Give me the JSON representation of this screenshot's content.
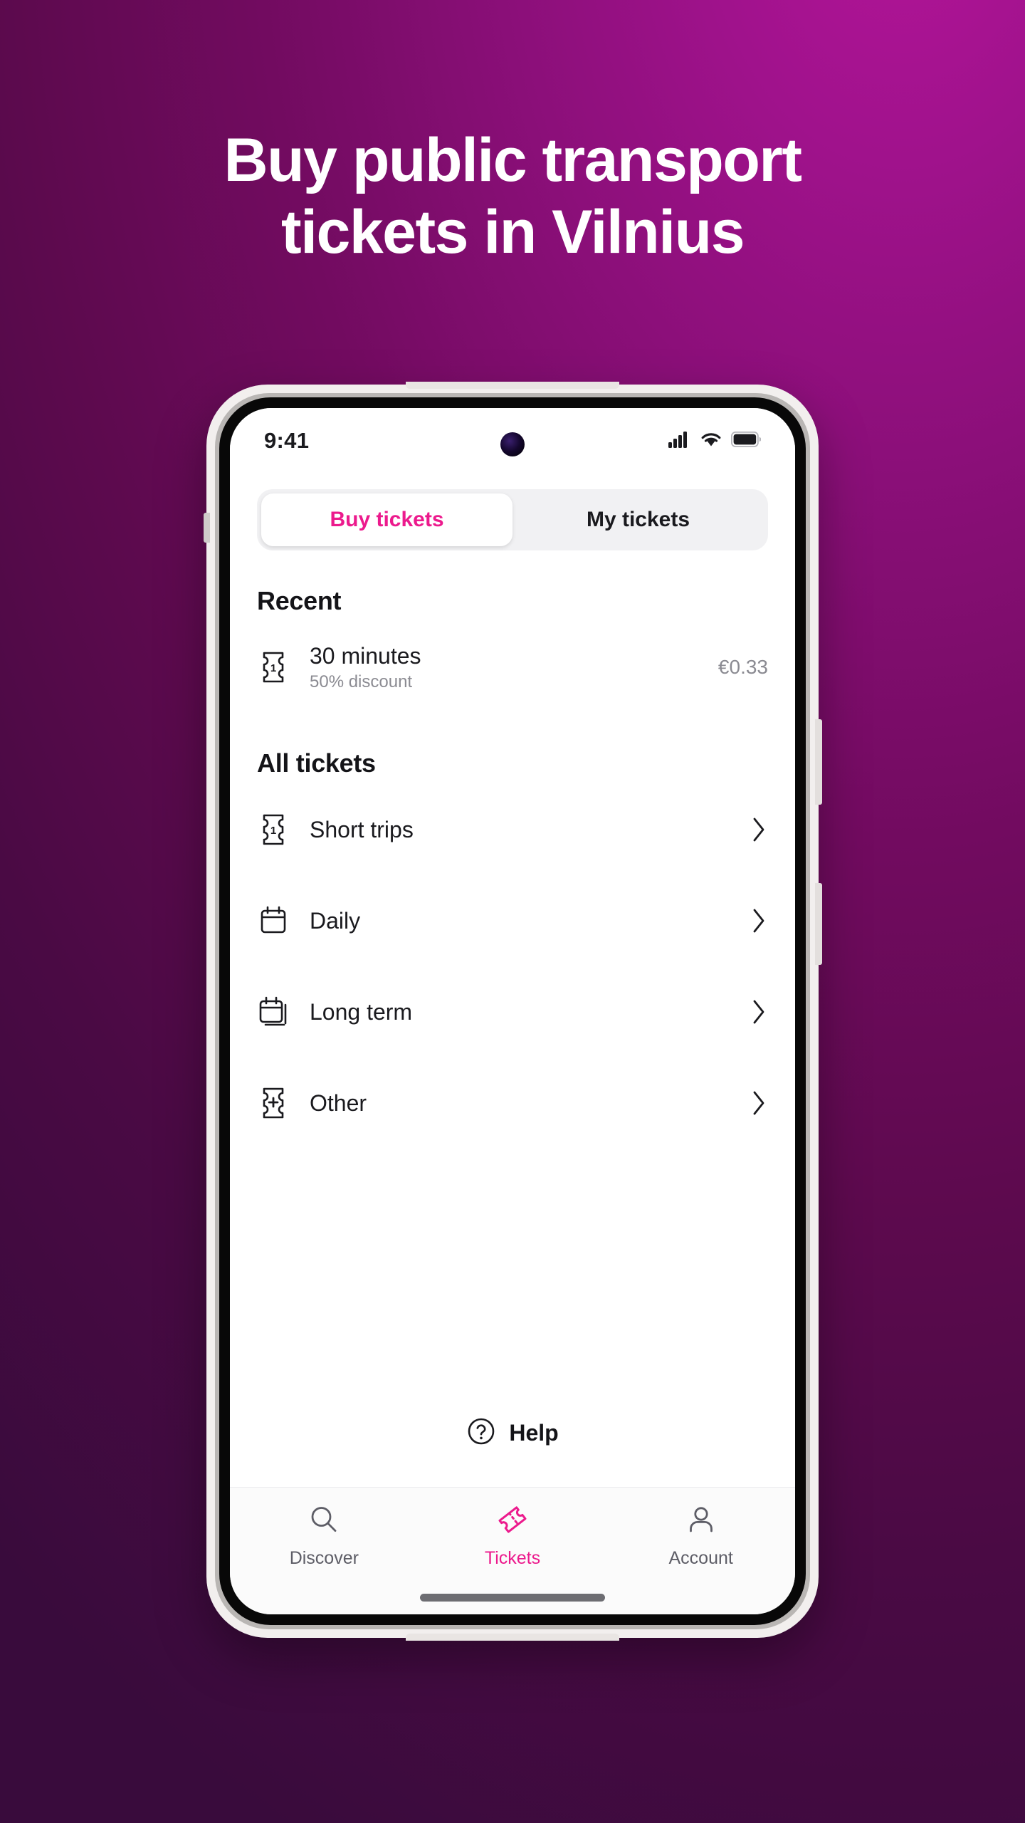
{
  "promo": {
    "headline_line1": "Buy public transport",
    "headline_line2": "tickets in Vilnius",
    "bg_color_start": "#b5159a",
    "bg_color_end": "#390b3c"
  },
  "phone": {
    "status_bar": {
      "time": "9:41",
      "signal_icon": "cellular-signal-icon",
      "wifi_icon": "wifi-icon",
      "battery_icon": "battery-full-icon",
      "camera": "front-camera-punchhole"
    },
    "tabs": [
      {
        "label": "Buy tickets",
        "active": true
      },
      {
        "label": "My tickets",
        "active": false
      }
    ],
    "recent": {
      "title": "Recent",
      "items": [
        {
          "icon": "ticket-one-icon",
          "label": "30 minutes",
          "sub": "50% discount",
          "price": "€0.33"
        }
      ]
    },
    "all_tickets": {
      "title": "All tickets",
      "items": [
        {
          "icon": "ticket-one-icon",
          "label": "Short trips",
          "chevron": "chevron-right-icon"
        },
        {
          "icon": "calendar-icon",
          "label": "Daily",
          "chevron": "chevron-right-icon"
        },
        {
          "icon": "calendar-stack-icon",
          "label": "Long term",
          "chevron": "chevron-right-icon"
        },
        {
          "icon": "ticket-plus-icon",
          "label": "Other",
          "chevron": "chevron-right-icon"
        }
      ]
    },
    "help": {
      "label": "Help",
      "icon": "question-circle-icon"
    },
    "bottom_nav": {
      "accent_color": "#ec1a8d",
      "inactive_color": "#5d5d66",
      "items": [
        {
          "label": "Discover",
          "icon": "search-icon",
          "active": false
        },
        {
          "label": "Tickets",
          "icon": "ticket-icon",
          "active": true
        },
        {
          "label": "Account",
          "icon": "person-icon",
          "active": false
        }
      ]
    }
  }
}
